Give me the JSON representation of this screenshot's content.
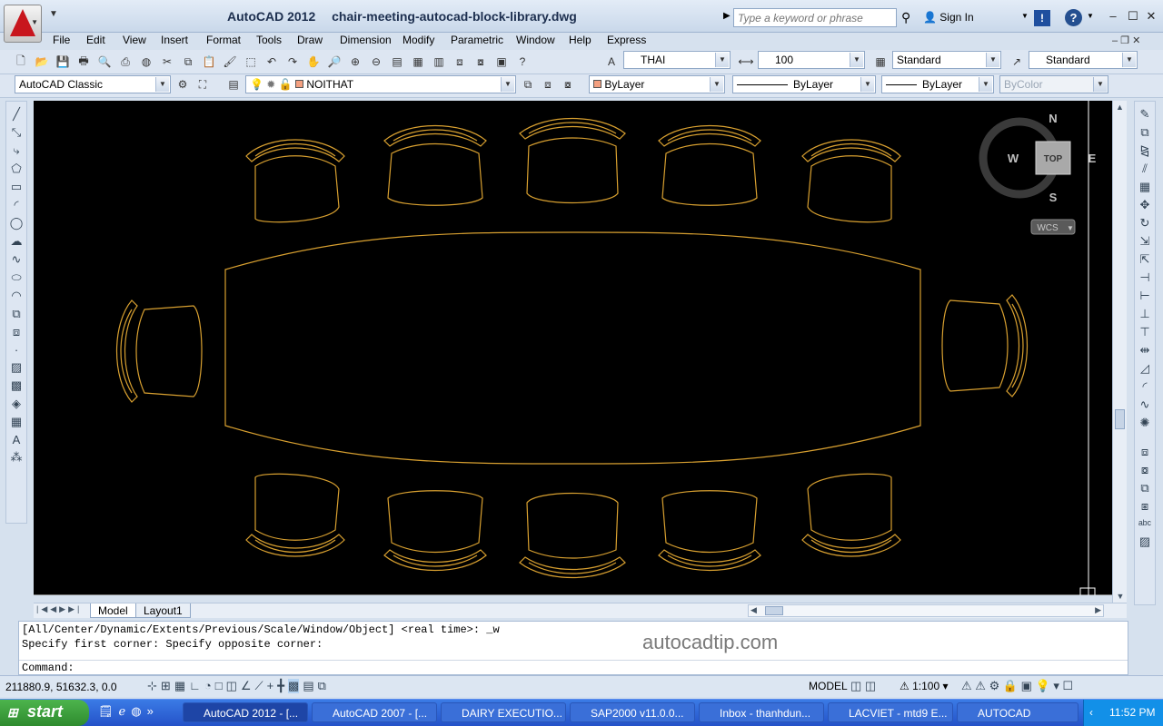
{
  "titlebar": {
    "app_title": "AutoCAD 2012",
    "file_name": "chair-meeting-autocad-block-library.dwg",
    "search_placeholder": "Type a keyword or phrase",
    "sign_in": "Sign In",
    "exchange_label": "!",
    "help_label": "?"
  },
  "menu": [
    "File",
    "Edit",
    "View",
    "Insert",
    "Format",
    "Tools",
    "Draw",
    "Dimension",
    "Modify",
    "Parametric",
    "Window",
    "Help",
    "Express"
  ],
  "toolbar": {
    "text_style": "THAI",
    "text_height": "100",
    "dim_style": "Standard",
    "table_style": "Standard"
  },
  "layers_row": {
    "workspace": "AutoCAD Classic",
    "layer": "NOITHAT",
    "color": "ByLayer",
    "linetype": "ByLayer",
    "lineweight": "ByLayer",
    "plotstyle": "ByColor"
  },
  "viewcube": {
    "north": "N",
    "south": "S",
    "east": "E",
    "west": "W",
    "top": "TOP",
    "wcs": "WCS"
  },
  "tabs": [
    "Model",
    "Layout1"
  ],
  "command": {
    "line1": "[All/Center/Dynamic/Extents/Previous/Scale/Window/Object] <real time>: _w",
    "line2": "Specify first corner: Specify opposite corner:",
    "prompt": "Command:",
    "watermark": "autocadtip.com"
  },
  "status": {
    "coords": "211880.9, 51632.3, 0.0",
    "model": "MODEL",
    "scale": "1:100"
  },
  "taskbar": {
    "start": "start",
    "tasks": [
      "AutoCAD 2012 - [...",
      "AutoCAD 2007 - [...",
      "DAIRY EXECUTIO...",
      "SAP2000 v11.0.0...",
      "Inbox - thanhdun...",
      "LACVIET - mtd9 E...",
      "AUTOCAD"
    ],
    "clock": "11:52 PM"
  },
  "colors": {
    "drawing_line": "#d8a030",
    "canvas_bg": "#000000",
    "taskbar": "#2452c8"
  }
}
